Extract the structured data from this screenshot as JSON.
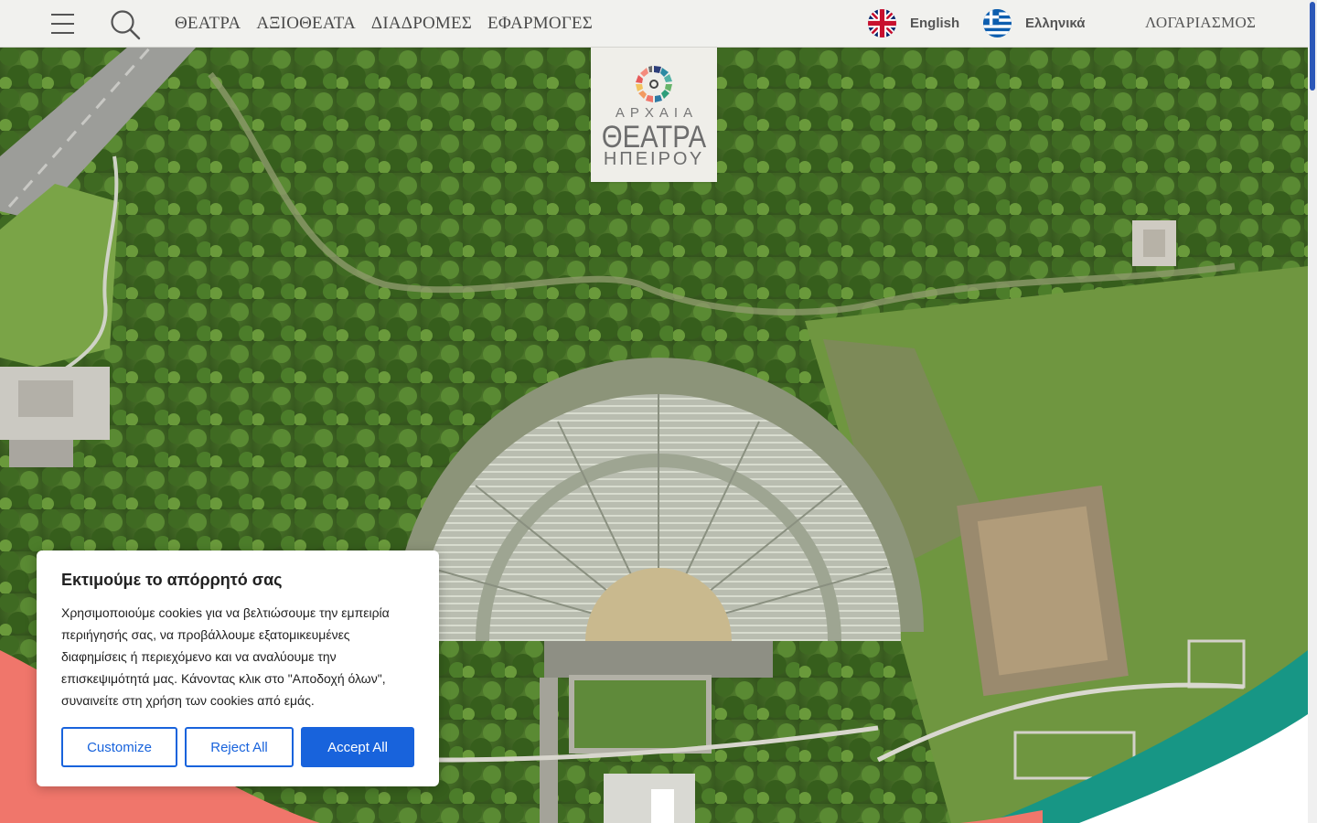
{
  "nav": {
    "items": [
      {
        "label": "ΘΕΑΤΡΑ"
      },
      {
        "label": "ΑΞΙΟΘΕΑΤΑ"
      },
      {
        "label": "ΔΙΑΔΡΟΜΕΣ"
      },
      {
        "label": "ΕΦΑΡΜΟΓΕΣ"
      }
    ],
    "icons": {
      "menu": "hamburger-menu-icon",
      "search": "search-icon"
    }
  },
  "languages": [
    {
      "label": "English",
      "flag": "uk-flag-icon"
    },
    {
      "label": "Ελληνικά",
      "flag": "greece-flag-icon"
    }
  ],
  "account_label": "ΛΟΓΑΡΙΑΣΜΟΣ",
  "logo": {
    "line1": "ΑΡΧΑΙΑ",
    "line2": "ΘΕΑΤΡΑ",
    "line3": "ΗΠΕΙΡΟΥ"
  },
  "cookie": {
    "title": "Εκτιμούμε το απόρρητό σας",
    "text": "Χρησιμοποιούμε cookies για να βελτιώσουμε την εμπειρία περιήγησής σας, να προβάλλουμε εξατομικευμένες διαφημίσεις ή περιεχόμενο και να αναλύουμε την επισκεψιμότητά μας. Κάνοντας κλικ στο \"Αποδοχή όλων\", συναινείτε στη χρήση των cookies από εμάς.",
    "buttons": {
      "customize": "Customize",
      "reject": "Reject All",
      "accept": "Accept All"
    }
  },
  "colors": {
    "topbar_bg": "#f1f1ee",
    "accent_blue": "#1863dc",
    "wave_coral": "#f0766b",
    "wave_teal": "#179685",
    "scroll_thumb": "#2b57b8"
  }
}
